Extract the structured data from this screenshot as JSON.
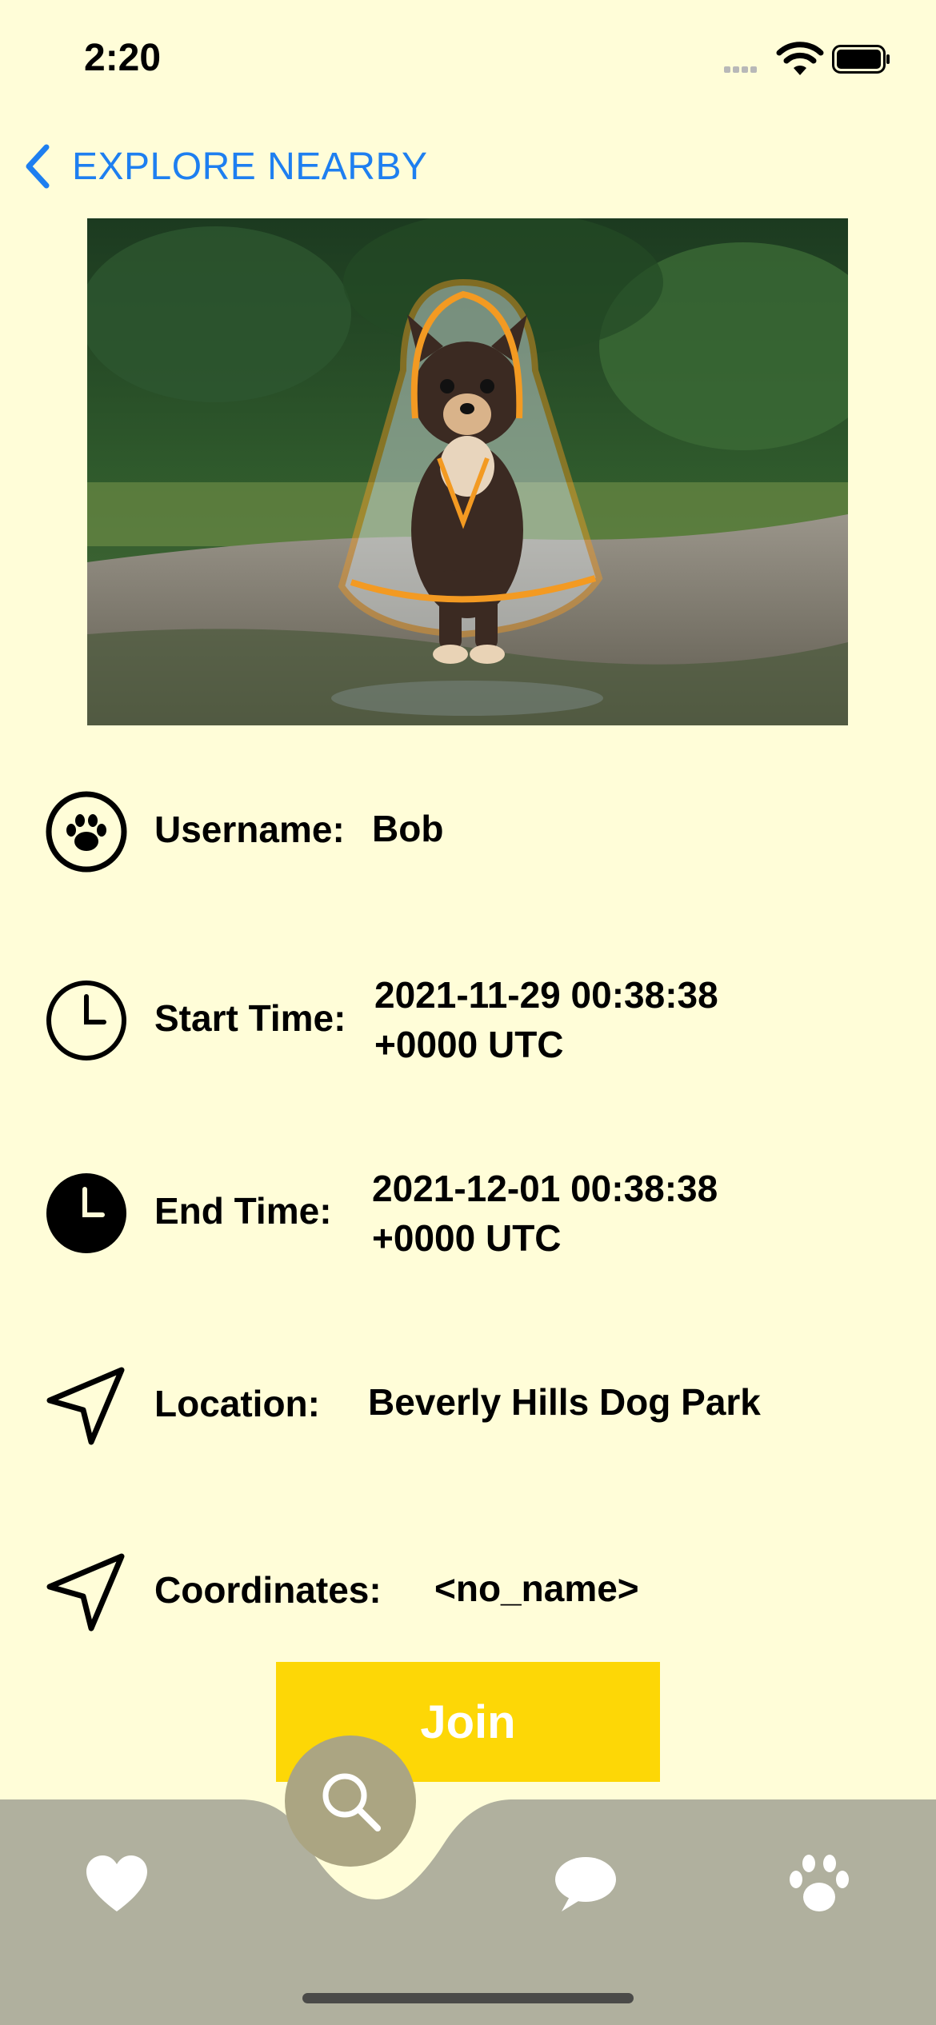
{
  "status_bar": {
    "time": "2:20"
  },
  "nav": {
    "back_label": "EXPLORE NEARBY"
  },
  "hero": {
    "alt": "Chihuahua wearing a transparent raincoat with orange trim"
  },
  "details": {
    "username": {
      "label": "Username:",
      "value": "Bob",
      "icon": "paw-circle-icon"
    },
    "start_time": {
      "label": "Start Time:",
      "value_line1": "2021-11-29 00:38:38",
      "value_line2": "+0000 UTC",
      "icon": "clock-outline-icon"
    },
    "end_time": {
      "label": "End Time:",
      "value_line1": "2021-12-01 00:38:38",
      "value_line2": "+0000 UTC",
      "icon": "clock-filled-icon"
    },
    "location": {
      "label": "Location:",
      "value": "Beverly Hills Dog Park",
      "icon": "location-arrow-icon"
    },
    "coordinates": {
      "label": "Coordinates:",
      "value": "<no_name>",
      "icon": "location-arrow-icon"
    }
  },
  "actions": {
    "join_label": "Join"
  },
  "tabbar": {
    "tabs": [
      "heart-icon",
      "search-icon",
      "chat-bubble-icon",
      "paw-icon"
    ]
  },
  "colors": {
    "background": "#FFFDD8",
    "accent_link": "#1E7FF0",
    "join_button": "#FDD706",
    "tabbar": "#B0B09E",
    "fab": "#ABA582"
  }
}
